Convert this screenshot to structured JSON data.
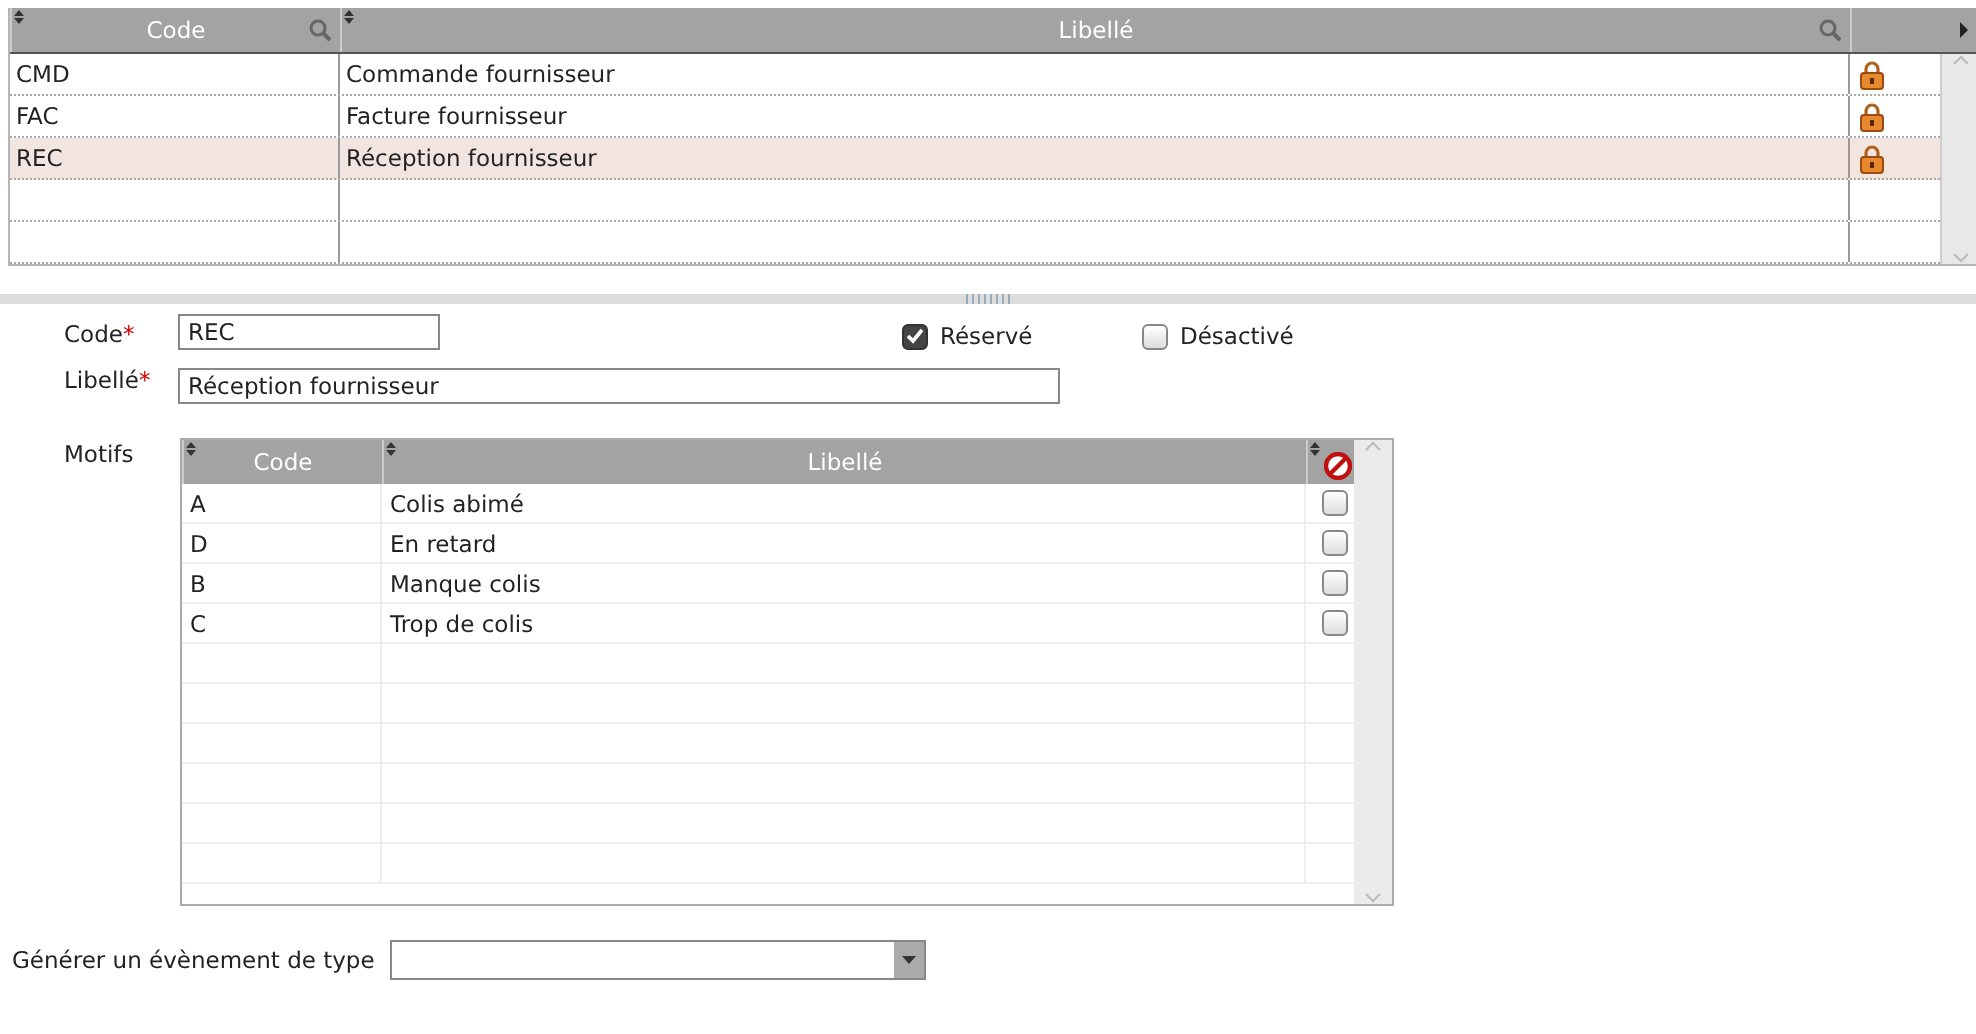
{
  "types_table": {
    "columns": [
      "Code",
      "Libellé"
    ],
    "rows": [
      {
        "code": "CMD",
        "label": "Commande fournisseur",
        "locked": true,
        "selected": false
      },
      {
        "code": "FAC",
        "label": "Facture fournisseur",
        "locked": true,
        "selected": false
      },
      {
        "code": "REC",
        "label": "Réception fournisseur",
        "locked": true,
        "selected": true
      }
    ]
  },
  "form": {
    "code": {
      "label": "Code",
      "required_mark": "*",
      "value": "REC"
    },
    "label": {
      "label": "Libellé",
      "required_mark": "*",
      "value": "Réception fournisseur"
    },
    "checkboxes": [
      {
        "label": "Réservé",
        "checked": true
      },
      {
        "label": "Désactivé",
        "checked": false
      }
    ],
    "motifs": {
      "label": "Motifs",
      "columns": [
        "Code",
        "Libellé"
      ],
      "rows": [
        {
          "code": "A",
          "label": "Colis abimé",
          "checked": false
        },
        {
          "code": "D",
          "label": "En retard",
          "checked": false
        },
        {
          "code": "B",
          "label": "Manque colis",
          "checked": false
        },
        {
          "code": "C",
          "label": "Trop de colis",
          "checked": false
        }
      ]
    },
    "event_type": {
      "label": "Générer un évènement de type"
    }
  }
}
